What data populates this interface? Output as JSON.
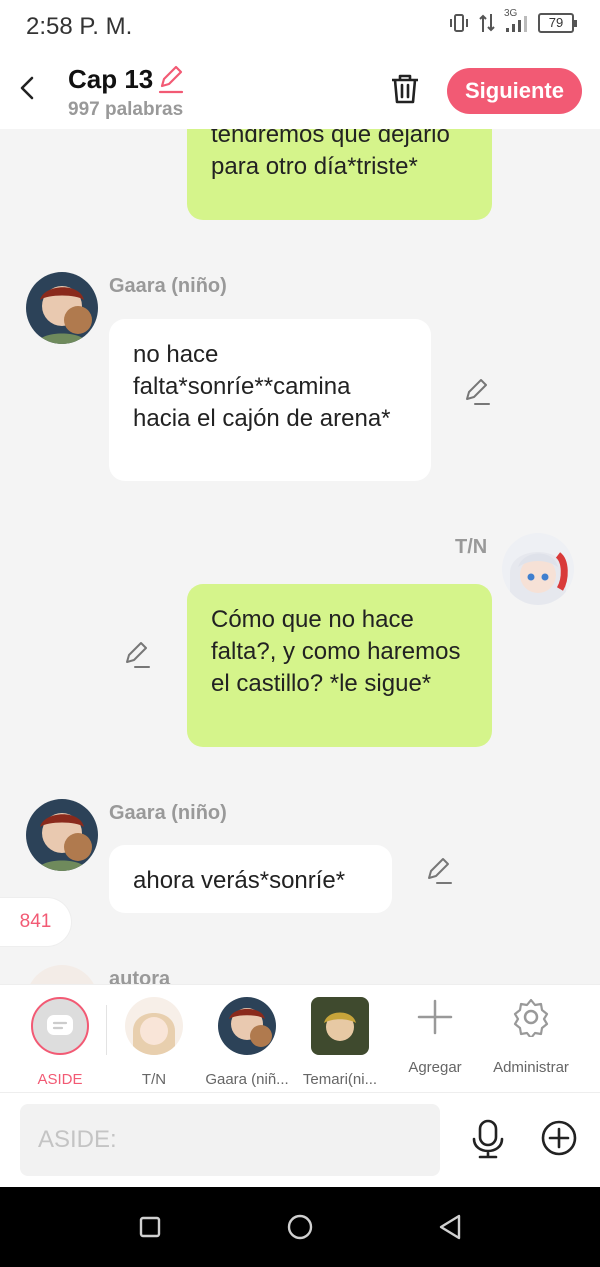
{
  "status_bar": {
    "time": "2:58 P. M.",
    "network": "3G",
    "battery": "79"
  },
  "header": {
    "title": "Cap 13",
    "word_count": "997 palabras",
    "next_label": "Siguiente"
  },
  "messages": [
    {
      "speaker": "T/N",
      "side": "right",
      "text": "tendremos que dejarlo para otro día*triste*"
    },
    {
      "speaker": "Gaara (niño)",
      "side": "left",
      "text": "no hace falta*sonríe**camina hacia el cajón de arena*"
    },
    {
      "speaker": "T/N",
      "side": "right",
      "text": "Cómo que no hace falta?, y como haremos el castillo? *le sigue*"
    },
    {
      "speaker": "Gaara (niño)",
      "side": "left",
      "text": "ahora verás*sonríe*"
    },
    {
      "speaker": "autora",
      "side": "left",
      "text": ""
    }
  ],
  "counter": "841",
  "characters": [
    {
      "label": "ASIDE",
      "selected": true
    },
    {
      "label": "T/N"
    },
    {
      "label": "Gaara (niñ..."
    },
    {
      "label": "Temari(ni..."
    },
    {
      "label": "Agregar",
      "icon": "plus-icon"
    },
    {
      "label": "Administrar",
      "icon": "gear-icon"
    }
  ],
  "input": {
    "placeholder": "ASIDE:"
  },
  "colors": {
    "accent": "#f25a74",
    "bubble_right": "#d5f48b",
    "bubble_left": "#ffffff",
    "background": "#f4f4f4"
  }
}
